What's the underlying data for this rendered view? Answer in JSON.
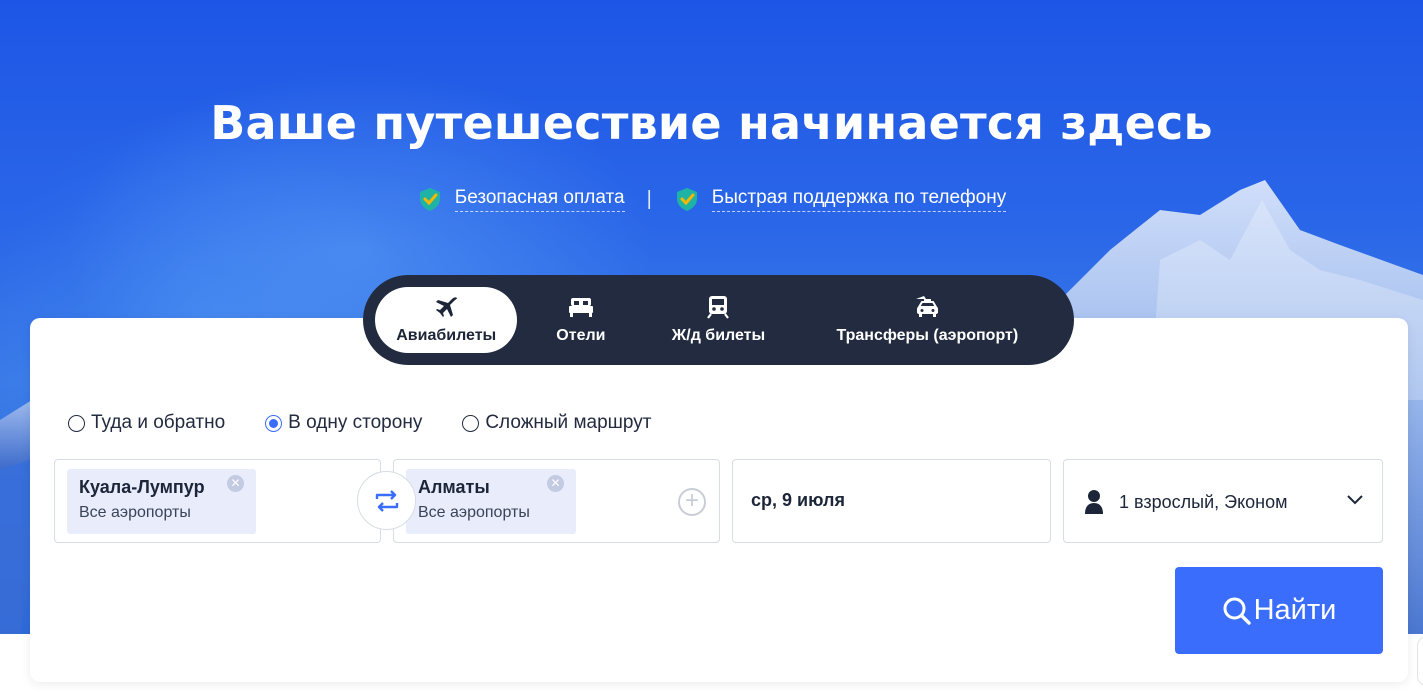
{
  "hero": {
    "title": "Ваше путешествие начинается здесь",
    "features": [
      {
        "icon": "shield-check-icon",
        "label": "Безопасная оплата"
      },
      {
        "icon": "shield-check-icon",
        "label": "Быстрая поддержка по телефону"
      }
    ],
    "separator": "|"
  },
  "tabs": [
    {
      "icon": "plane-icon",
      "label": "Авиабилеты",
      "active": true
    },
    {
      "icon": "bed-icon",
      "label": "Отели",
      "active": false
    },
    {
      "icon": "train-icon",
      "label": "Ж/д билеты",
      "active": false
    },
    {
      "icon": "taxi-icon",
      "label": "Трансферы (аэропорт)",
      "active": false
    }
  ],
  "trip_type": {
    "options": [
      "Туда и обратно",
      "В одну сторону",
      "Сложный маршрут"
    ],
    "selected": "В одну сторону"
  },
  "from": {
    "city": "Куала-Лумпур",
    "sub": "Все аэропорты"
  },
  "to": {
    "city": "Алматы",
    "sub": "Все аэропорты"
  },
  "date": {
    "value": "ср, 9 июля"
  },
  "passengers": {
    "value": "1 взрослый, Эконом"
  },
  "search": {
    "label": "Найти"
  },
  "colors": {
    "accent": "#3a6dfb",
    "tab_bar": "#222b3f",
    "chip": "#e8ecfb",
    "hero": "#2a66e8"
  }
}
